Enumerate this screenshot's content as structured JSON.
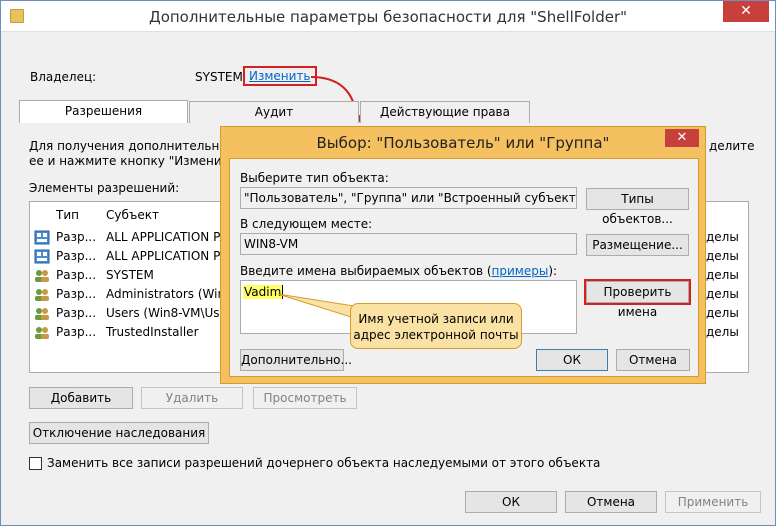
{
  "window": {
    "title": "Дополнительные параметры безопасности  для \"ShellFolder\"",
    "close": "✕"
  },
  "owner": {
    "label": "Владелец:",
    "value": "SYSTEM",
    "change_link": "Изменить"
  },
  "tabs": [
    "Разрешения",
    "Аудит",
    "Действующие права доступа"
  ],
  "info_text_1": "Для получения дополнительных с",
  "info_text_2": "ее и нажмите кнопку \"Изменить\" (",
  "info_text_right": "делите",
  "entries_label": "Элементы разрешений:",
  "columns": [
    "Тип",
    "Субъект"
  ],
  "rows": [
    {
      "type": "Разр...",
      "subject": "ALL APPLICATION PA",
      "right": "делы"
    },
    {
      "type": "Разр...",
      "subject": "ALL APPLICATION PA",
      "right": "делы"
    },
    {
      "type": "Разр...",
      "subject": "SYSTEM",
      "right": "делы"
    },
    {
      "type": "Разр...",
      "subject": "Administrators (Win8-",
      "right": "делы"
    },
    {
      "type": "Разр...",
      "subject": "Users (Win8-VM\\Users",
      "right": "делы"
    },
    {
      "type": "Разр...",
      "subject": "TrustedInstaller",
      "right": "делы"
    }
  ],
  "buttons": {
    "add": "Добавить",
    "remove": "Удалить",
    "view": "Просмотреть",
    "disable_inheritance": "Отключение наследования",
    "ok": "ОК",
    "cancel": "Отмена",
    "apply": "Применить"
  },
  "replace_checkbox": "Заменить все записи разрешений дочернего объекта наследуемыми от этого объекта",
  "dialog": {
    "title": "Выбор: \"Пользователь\" или \"Группа\"",
    "close": "✕",
    "object_type_label": "Выберите тип объекта:",
    "object_type_value": "\"Пользователь\", \"Группа\" или \"Встроенный субъект безопасно",
    "object_types_button": "Типы объектов...",
    "location_label": "В следующем месте:",
    "location_value": "WIN8-VM",
    "locations_button": "Размещение...",
    "names_label_prefix": "Введите имена выбираемых объектов (",
    "names_label_link": "примеры",
    "names_label_suffix": "):",
    "names_value": "Vadim",
    "check_names_button": "Проверить имена",
    "advanced_button": "Дополнительно...",
    "ok_button": "ОК",
    "cancel_button": "Отмена"
  },
  "callout": {
    "line1": "Имя учетной записи или",
    "line2": "адрес электронной почты"
  },
  "colors": {
    "dialog_frame": "#f5c060",
    "highlight_red": "#d42020",
    "callout_bg": "#f9e2a4",
    "name_highlight": "#ffff66"
  }
}
